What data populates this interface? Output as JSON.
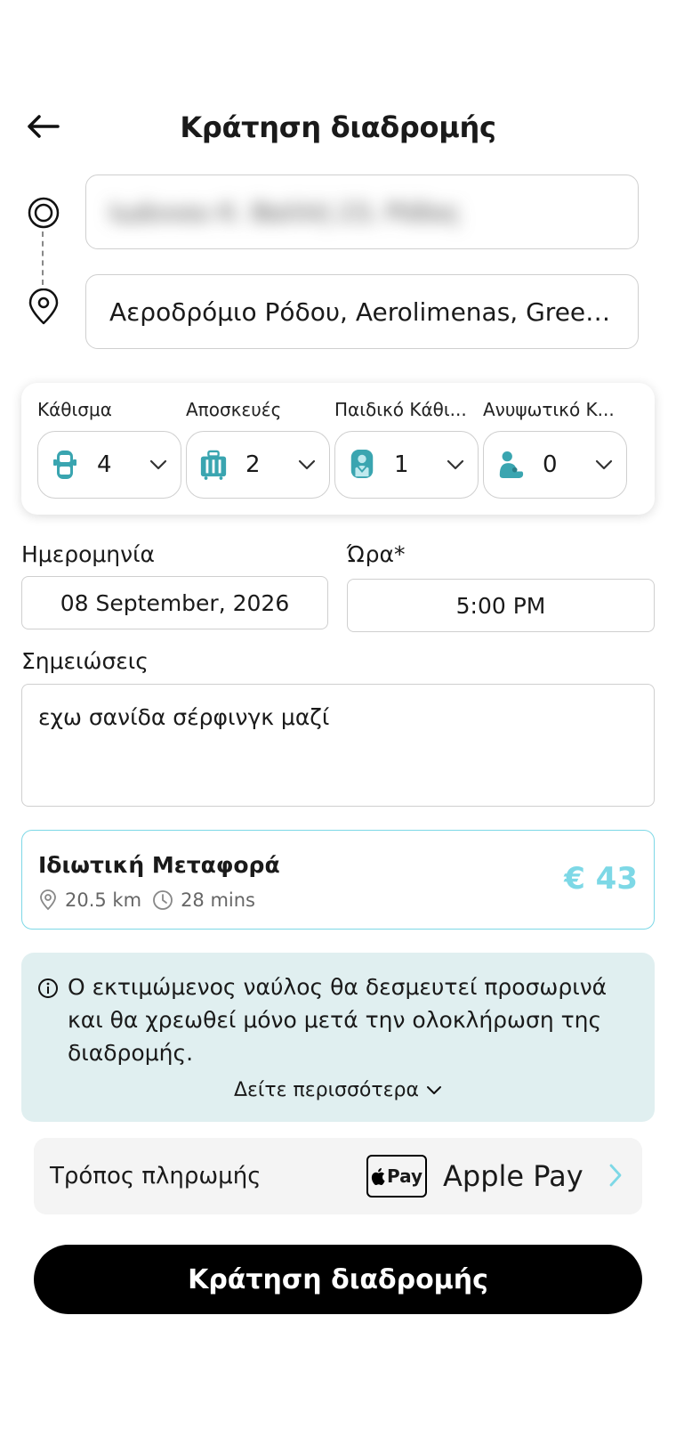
{
  "header": {
    "title": "Κράτηση διαδρομής"
  },
  "route": {
    "pickup_value": "Ιωάννου Κ. Βαλλή 23, Ρόδος",
    "dropoff_value": "Αεροδρόμιο Ρόδου, Aerolimenas, Gree…"
  },
  "options": [
    {
      "label": "Κάθισμα",
      "value": "4",
      "icon": "car-seat-icon"
    },
    {
      "label": "Αποσκευές",
      "value": "2",
      "icon": "luggage-icon"
    },
    {
      "label": "Παιδικό Κάθι...",
      "value": "1",
      "icon": "child-seat-icon"
    },
    {
      "label": "Ανυψωτικό Κ...",
      "value": "0",
      "icon": "booster-seat-icon"
    }
  ],
  "schedule": {
    "date_label": "Ημερομηνία",
    "date_value": "08 September, 2026",
    "time_label": "Ώρα*",
    "time_value": "5:00 PM"
  },
  "notes": {
    "label": "Σημειώσεις",
    "value": "εχω σανίδα σέρφινγκ μαζί"
  },
  "ride": {
    "title": "Ιδιωτική Μεταφορά",
    "distance": "20.5 km",
    "duration": "28 mins",
    "price": "€ 43"
  },
  "info": {
    "text": "Ο εκτιμώμενος ναύλος θα δεσμευτεί προσωρινά και θα χρεωθεί μόνο μετά την ολοκλήρωση της διαδρομής.",
    "more": "Δείτε περισσότερα"
  },
  "payment": {
    "label": "Τρόπος πληρωμής",
    "badge": "Pay",
    "method": "Apple Pay"
  },
  "cta": {
    "label": "Κράτηση διαδρομής"
  },
  "colors": {
    "accent": "#7dd8e6",
    "option_icon": "#3aa5b0",
    "info_bg": "#e0eff0",
    "cta_bg": "#000000"
  }
}
